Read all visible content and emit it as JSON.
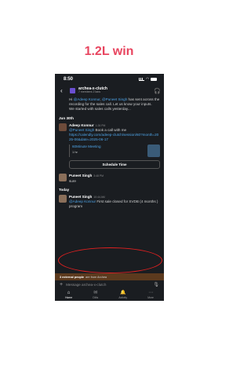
{
  "caption": "1.2L win",
  "status": {
    "time": "8:50"
  },
  "channel": {
    "name": "archea-x-clutch",
    "subtitle": "7 members  2 tabs"
  },
  "messages": {
    "top_text_pre": "Hi ",
    "top_mention1": "@Adeep Konnur",
    "top_mention2": "@Puneet Singh",
    "top_text_post": " has sent across the recording for the sales call. Let us know your inputs.",
    "top_text_2": "We started with sales calls yesterday...",
    "day1": "Jun 30th",
    "adeep_author": "Adeep Konnur",
    "adeep_time": "1:26 PM",
    "adeep_mention": "@Puneet Singh",
    "adeep_text": " Book a call with me",
    "adeep_link": "https://calendly.com/adeep-clutch/session/60?month=2025-06&date=2025-06-17",
    "unfurl_title": "60Minute Meeting",
    "unfurl_duration": "1 hr",
    "schedule_button": "Schedule Time",
    "puneet1_author": "Puneet Singh",
    "puneet1_time": "3:48 PM",
    "puneet1_text": "sure",
    "day2": "Today",
    "puneet2_author": "Puneet Singh",
    "puneet2_time": "10:44 AM",
    "puneet2_mention": "@Adeep Konnur",
    "puneet2_text": " First sale closed for SVDB (4 months ) program"
  },
  "external_bar": {
    "count_text": "3 external people",
    "suffix": "are from Archea"
  },
  "composer": {
    "placeholder": "Message archea-x-clutch"
  },
  "tabs": [
    {
      "label": "Home",
      "icon": "home-icon"
    },
    {
      "label": "DMs",
      "icon": "dms-icon"
    },
    {
      "label": "Activity",
      "icon": "bell-icon"
    },
    {
      "label": "More",
      "icon": "more-icon"
    }
  ],
  "colors": {
    "caption": "#e8455f",
    "link": "#4ea3e6",
    "highlight": "#e02020",
    "background": "#1a1d21"
  }
}
